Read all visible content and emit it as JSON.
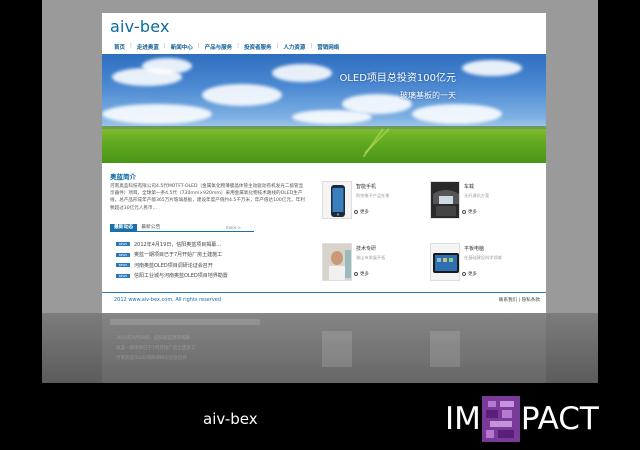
{
  "site": {
    "logo": "aiv-bex",
    "nav": [
      "首页",
      "走进奥蓝",
      "新闻中心",
      "产品与服务",
      "投资者服务",
      "人力资源",
      "营销网络"
    ]
  },
  "banner": {
    "line1": "OLED项目总投资100亿元",
    "line2": "玻璃基板的一天"
  },
  "intro": {
    "title": "奥蓝简介",
    "text": "河南奥蓝科技有限公司4.5代MOTFT-OLED（金属氧化物薄膜晶体管主动驱动有机发光二极管显示器件）项目，全球第一条4.5代（730mm×920mm）采用金属氧化物技术路线的OLED生产线，总产品形成年产能365万片玻璃基板，建设年度产值约4.5千万米，年产值达100亿元，年利税超过30亿元人民币..."
  },
  "news_tabs": {
    "tabs": [
      "最新动态",
      "最新公告"
    ],
    "more": "more >",
    "badge": "NEWS",
    "items": [
      "2012年4月19日，信阳奥蓝项目揭幕...",
      "奥蓝一期项目已于7月开始厂房土建施工",
      "河南奥蓝OLED项目调研论证会召开",
      "信阳工业城与河南奥蓝OLED项目地界勘置"
    ]
  },
  "products": [
    {
      "name": "智能手机",
      "desc": "防突电子产品在册",
      "more": "更多"
    },
    {
      "name": "车载",
      "desc": "光纤通讯方案",
      "more": "更多"
    },
    {
      "name": "技术专研",
      "desc": "湖山市发展开拓",
      "more": "更多"
    },
    {
      "name": "平板电脑",
      "desc": "在基础建设科学领域",
      "more": "更多"
    }
  ],
  "footer": {
    "copyright": "2012 www.aiv-bex.com, All rights reserved",
    "links": "联系我们 | 隐私条款"
  },
  "caption": "aiv-bex",
  "brand": {
    "left": "IM",
    "right": "PACT",
    "mark_color": "#7a3a9a"
  },
  "colors": {
    "accent": "#0b6aa2",
    "tab_active": "#1b6fa8",
    "field_green": "#62a921"
  }
}
